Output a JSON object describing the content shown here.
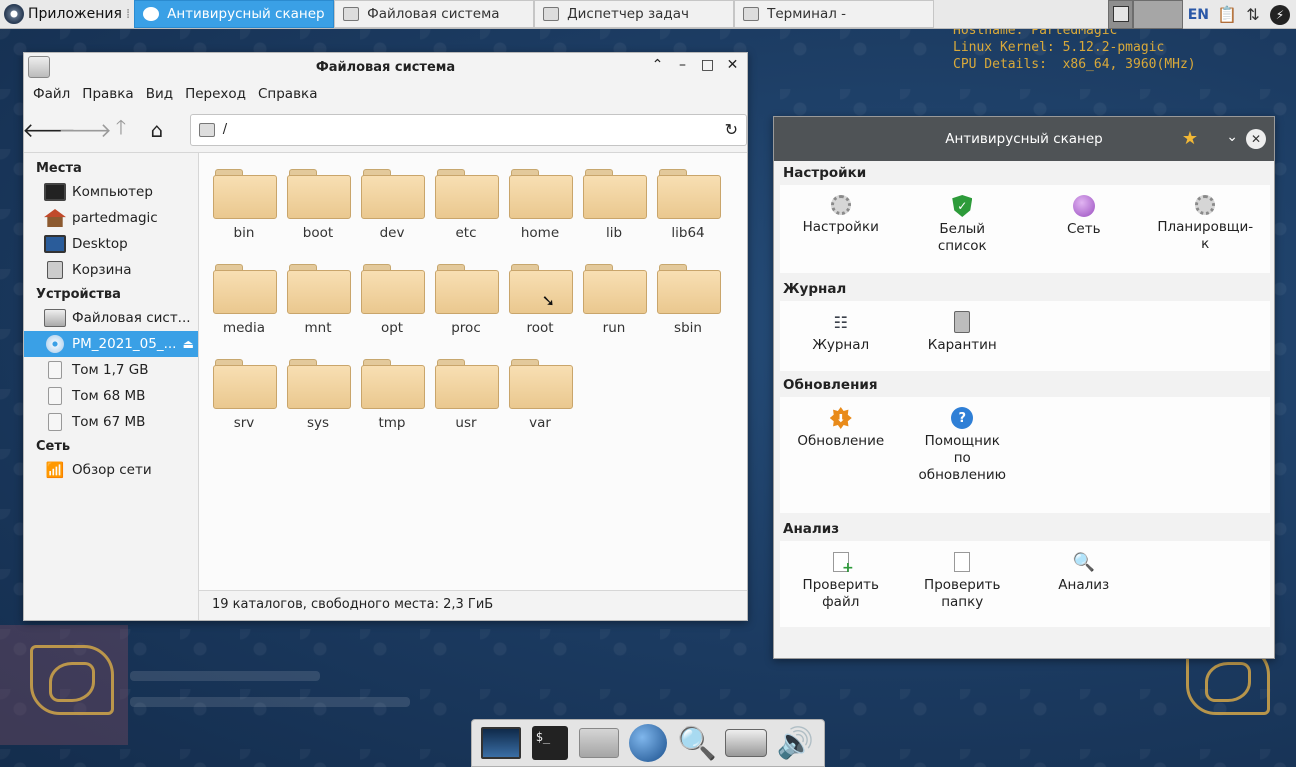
{
  "taskbar": {
    "start_label": "Приложения",
    "tasks": [
      {
        "label": "Антивирусный сканер",
        "active": true
      },
      {
        "label": "Файловая система",
        "active": false
      },
      {
        "label": "Диспетчер задач",
        "active": false
      },
      {
        "label": "Терминал -",
        "active": false
      }
    ],
    "language": "EN"
  },
  "sysinfo": {
    "hostname": "Hostname: PartedMagic",
    "kernel": "Linux Kernel: 5.12.2-pmagic",
    "cpu": "CPU Details:  x86_64, 3960(MHz)"
  },
  "file_manager": {
    "title": "Файловая система",
    "menu": [
      "Файл",
      "Правка",
      "Вид",
      "Переход",
      "Справка"
    ],
    "location": "/",
    "sidebar": {
      "places_header": "Места",
      "places": [
        "Компьютер",
        "partedmagic",
        "Desktop",
        "Корзина"
      ],
      "devices_header": "Устройства",
      "devices": [
        "Файловая сист...",
        "PM_2021_05_...",
        "Том 1,7 GB",
        "Том 68 MB",
        "Том 67 MB"
      ],
      "network_header": "Сеть",
      "network": [
        "Обзор сети"
      ]
    },
    "folders": [
      "bin",
      "boot",
      "dev",
      "etc",
      "home",
      "lib",
      "lib64",
      "media",
      "mnt",
      "opt",
      "proc",
      "root",
      "run",
      "sbin",
      "srv",
      "sys",
      "tmp",
      "usr",
      "var"
    ],
    "status": "19 каталогов, свободного места: 2,3 ГиБ"
  },
  "antivirus": {
    "title": "Антивирусный сканер",
    "sections": [
      {
        "header": "Настройки",
        "items": [
          "Настройки",
          "Белый список",
          "Сеть",
          "Планировщи-к"
        ]
      },
      {
        "header": "Журнал",
        "items": [
          "Журнал",
          "Карантин"
        ]
      },
      {
        "header": "Обновления",
        "items": [
          "Обновление",
          "Помощник по обновлению"
        ]
      },
      {
        "header": "Анализ",
        "items": [
          "Проверить файл",
          "Проверить папку",
          "Анализ"
        ]
      }
    ]
  }
}
